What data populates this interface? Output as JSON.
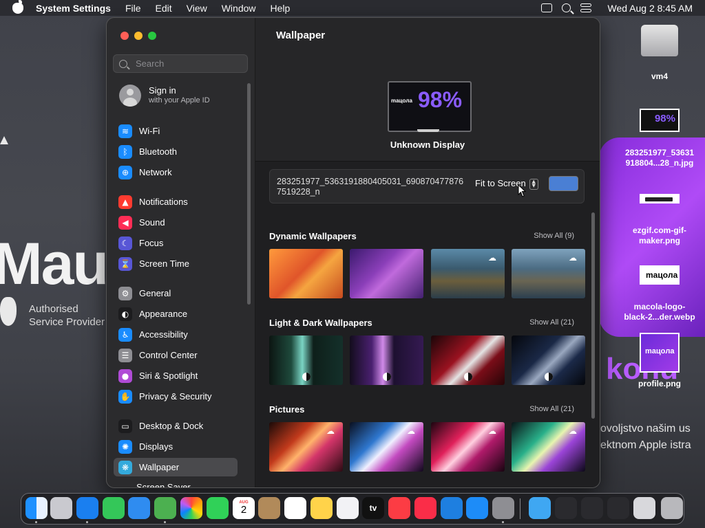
{
  "menubar": {
    "app_name": "System Settings",
    "menus": [
      "File",
      "Edit",
      "View",
      "Window",
      "Help"
    ],
    "datetime": "Wed Aug 2  8:45 AM"
  },
  "background": {
    "brand_fragment": "Mau",
    "brand_caption_line1": "Authorised",
    "brand_caption_line2": "Service Provider",
    "kon": "konu",
    "line1": "ovoljstvo našim us",
    "line2": "ektnom Apple istra"
  },
  "sidebar": {
    "search_placeholder": "Search",
    "signin_title": "Sign in",
    "signin_sub": "with your Apple ID",
    "items": [
      {
        "label": "Wi-Fi",
        "icon": "wifi-icon",
        "color": "#1a8cff",
        "glyph": "≋"
      },
      {
        "label": "Bluetooth",
        "icon": "bluetooth-icon",
        "color": "#1a8cff",
        "glyph": "ᛒ"
      },
      {
        "label": "Network",
        "icon": "network-icon",
        "color": "#1a8cff",
        "glyph": "⊕"
      },
      {
        "label": "Notifications",
        "icon": "notifications-icon",
        "color": "#ff3b30",
        "glyph": "▲"
      },
      {
        "label": "Sound",
        "icon": "sound-icon",
        "color": "#ff2d55",
        "glyph": "◀"
      },
      {
        "label": "Focus",
        "icon": "focus-icon",
        "color": "#5856d6",
        "glyph": "☾"
      },
      {
        "label": "Screen Time",
        "icon": "screen-time-icon",
        "color": "#5856d6",
        "glyph": "⌛"
      },
      {
        "label": "General",
        "icon": "general-icon",
        "color": "#8e8e93",
        "glyph": "⚙"
      },
      {
        "label": "Appearance",
        "icon": "appearance-icon",
        "color": "#1c1c1e",
        "glyph": "◐"
      },
      {
        "label": "Accessibility",
        "icon": "accessibility-icon",
        "color": "#1a8cff",
        "glyph": "♿"
      },
      {
        "label": "Control Center",
        "icon": "control-center-icon",
        "color": "#8e8e93",
        "glyph": "☰"
      },
      {
        "label": "Siri & Spotlight",
        "icon": "siri-icon",
        "color": "#b04bd6",
        "glyph": "●"
      },
      {
        "label": "Privacy & Security",
        "icon": "privacy-icon",
        "color": "#1a8cff",
        "glyph": "✋"
      },
      {
        "label": "Desktop & Dock",
        "icon": "desktop-dock-icon",
        "color": "#1c1c1e",
        "glyph": "▭"
      },
      {
        "label": "Displays",
        "icon": "displays-icon",
        "color": "#1a8cff",
        "glyph": "✺"
      },
      {
        "label": "Wallpaper",
        "icon": "wallpaper-icon",
        "color": "#34aadc",
        "glyph": "❋"
      }
    ],
    "partial_item": "Screen Saver"
  },
  "content": {
    "title": "Wallpaper",
    "preview_mac": "maцoлa",
    "preview_pct": "98%",
    "display_name": "Unknown Display",
    "filename": "283251977_5363191880405031_6908704778767519228_n",
    "fit_label": "Fit to Screen",
    "color_swatch": "#4a7fd4",
    "sections": [
      {
        "title": "Dynamic Wallpapers",
        "show_all": "Show All (9)"
      },
      {
        "title": "Light & Dark Wallpapers",
        "show_all": "Show All (21)"
      },
      {
        "title": "Pictures",
        "show_all": "Show All (21)"
      }
    ]
  },
  "desktop_icons": [
    {
      "label_line1": "vm4",
      "label_line2": ""
    },
    {
      "label_line1": "283251977_53631",
      "label_line2": "918804...28_n.jpg"
    },
    {
      "label_line1": "ezgif.com-gif-",
      "label_line2": "maker.png"
    },
    {
      "label_line1": "macola-logo-",
      "label_line2": "black-2...der.webp"
    },
    {
      "label_line1": "profile.png",
      "label_line2": ""
    }
  ],
  "desktop_thumbs": {
    "t1": "98%",
    "t3": "maцoлa",
    "t4": "maцoлa"
  },
  "dock": {
    "calendar_month": "AUG",
    "calendar_day": "2",
    "tv_label": "tv"
  },
  "colors": {
    "accent": "#1a8cff",
    "close": "#ff5f57",
    "minimize": "#febc2e",
    "zoom": "#28c840"
  }
}
